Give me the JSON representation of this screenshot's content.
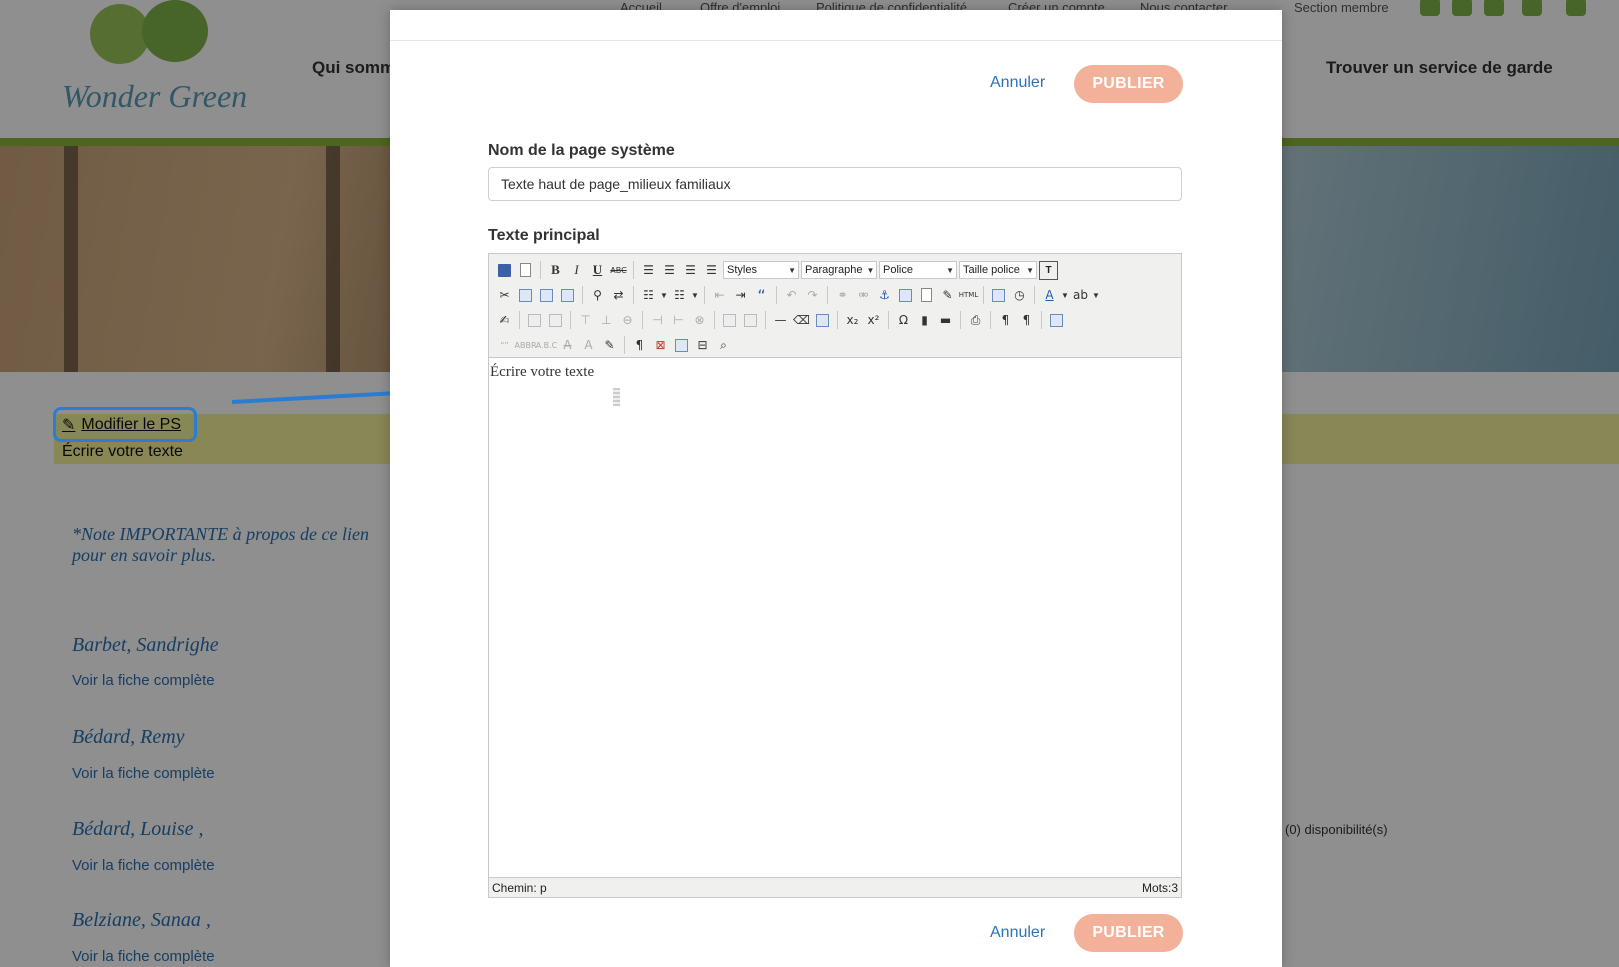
{
  "background": {
    "logo_text": "Wonder Green",
    "top_nav": [
      "Accueil",
      "Offre d'emploi",
      "Politique de confidentialité",
      "Créer un compte",
      "Nous contacter",
      "Section membre"
    ],
    "main_nav": [
      "Qui sommes",
      "Trouver un service de garde"
    ],
    "edit_link_label": "Modifier le PS",
    "edit_text": "Écrire votre texte",
    "notice": "*Note IMPORTANTE à propos de ce lien pour en savoir plus.",
    "list": [
      {
        "name": "Barbet, Sandrighe",
        "link": "Voir la fiche complète"
      },
      {
        "name": "Bédard, Remy",
        "link": "Voir la fiche complète"
      },
      {
        "name": "Bédard, Louise ,",
        "link": "Voir la fiche complète"
      },
      {
        "name": "Belziane, Sanaa ,",
        "link": "Voir la fiche complète"
      }
    ],
    "side_note": "(0) disponibilité(s)"
  },
  "modal": {
    "cancel_label": "Annuler",
    "publish_label": "PUBLIER",
    "name_label": "Nom de la page système",
    "name_value": "Texte haut de page_milieux familiaux",
    "main_text_label": "Texte principal",
    "editor": {
      "styles": "Styles",
      "format": "Paragraphe",
      "font": "Police",
      "size": "Taille police",
      "content": "Écrire votre texte",
      "path": "Chemin: p",
      "word_count": "Mots:3"
    }
  },
  "colors": {
    "accent_blue": "#2a7dd1",
    "publish_bg": "#f4b199",
    "link_blue": "#2a73b8",
    "brand_green": "#8bb43a",
    "edit_band": "#f2f09a"
  }
}
